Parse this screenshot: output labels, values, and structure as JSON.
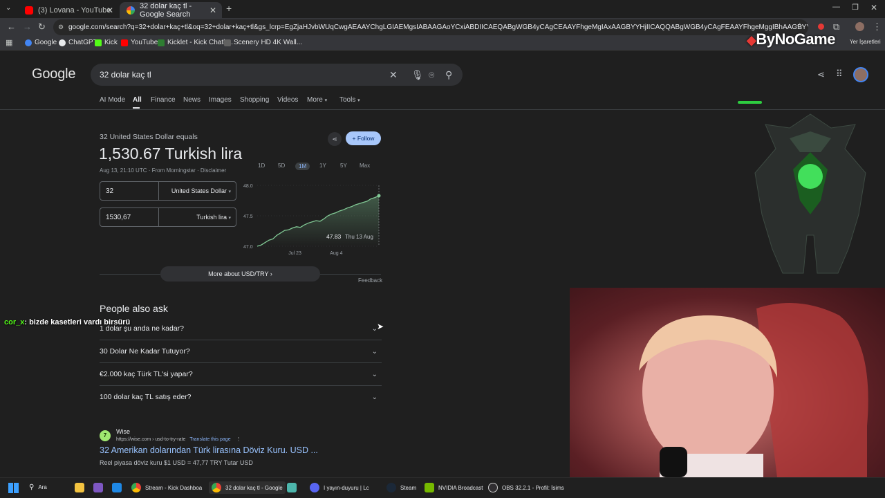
{
  "browser": {
    "tabs": [
      {
        "label": "(3) Lovana - YouTube",
        "active": false
      },
      {
        "label": "32 dolar kaç tl - Google Search",
        "active": true
      }
    ],
    "new_tab_glyph": "+",
    "url": "google.com/search?q=32+dolar+kaç+tl&oq=32+dolar+kaç+tl&gs_lcrp=EgZjaHJvbWUqCwgAEAAYChgLGIAEMgsIABAAGAoYCxiABDIICAEQABgWGB4yCAgCEAAYFhgeMgIAxAAGBYYHjIICAQQABgWGB4yCAgFEAAYFhgeMggIBhAAGBYYHjIICAcQABgWGB4yCAgIEAAYFh...",
    "bookmarks": [
      "Google",
      "ChatGPT",
      "Kick",
      "YouTube",
      "Kicklet - Kick Chatb...",
      "Scenery HD 4K Wall..."
    ],
    "bookmarks_right": "Yer İşaretleri"
  },
  "overlay": {
    "brand": "ByNoGame",
    "chat_user": "cor_x",
    "chat_message": ": bizde kasetleri vardı birsürü"
  },
  "google": {
    "logo": "Google",
    "query": "32 dolar kaç tl",
    "nav": [
      "AI Mode",
      "All",
      "Finance",
      "News",
      "Images",
      "Shopping",
      "Videos",
      "More",
      "Tools"
    ],
    "converter": {
      "equals_label": "32 United States Dollar equals",
      "result": "1,530.67 Turkish lira",
      "timestamp": "Aug 13, 21:10 UTC",
      "source": "· From Morningstar · Disclaimer",
      "follow": "Follow",
      "amount_from": "32",
      "currency_from": "United States Dollar",
      "amount_to": "1530,67",
      "currency_to": "Turkish lira",
      "ranges": [
        "1D",
        "5D",
        "1M",
        "1Y",
        "5Y",
        "Max"
      ],
      "active_range": "1M",
      "more_about": "More about USD/TRY",
      "feedback": "Feedback"
    },
    "people_also_ask": {
      "title": "People also ask",
      "questions": [
        "1 dolar şu anda ne kadar?",
        "30 Dolar Ne Kadar Tutuyor?",
        "€2.000 kaç Türk TL'si yapar?",
        "100 dolar kaç TL satış eder?"
      ]
    },
    "result": {
      "site": "Wise",
      "url": "https://wise.com › usd-to-try-rate",
      "translate": "Translate this page",
      "title": "32 Amerikan dolarından Türk lirasına Döviz Kuru. USD ...",
      "snippet": "Reel piyasa döviz kuru $1 USD = 47,77 TRY Tutar USD"
    }
  },
  "chart_data": {
    "type": "line",
    "x_tick_labels": [
      "Jul 23",
      "Aug 4"
    ],
    "y_ticks": [
      48.0,
      47.5,
      47.0
    ],
    "y_tick_labels": [
      "48.0",
      "47.5",
      "47.0"
    ],
    "ylim": [
      47.0,
      48.0
    ],
    "values": [
      47.0,
      47.02,
      47.06,
      47.1,
      47.12,
      47.18,
      47.22,
      47.26,
      47.27,
      47.3,
      47.32,
      47.31,
      47.35,
      47.38,
      47.4,
      47.42,
      47.41,
      47.45,
      47.5,
      47.53,
      47.55,
      47.58,
      47.6,
      47.63,
      47.65,
      47.68,
      47.7,
      47.72,
      47.74,
      47.78,
      47.8,
      47.83
    ],
    "tooltip_value": "47.83",
    "tooltip_date": "Thu 13 Aug",
    "color": "#81c995"
  },
  "taskbar": {
    "search": "Ara",
    "items": [
      "Stream - Kick Dashboa",
      "32 dolar kaç tl - Google",
      "I yayın-duyuru | Lc",
      "Steam",
      "NVIDIA Broadcast",
      "OBS 32.2.1 - Profil: İsims"
    ]
  }
}
